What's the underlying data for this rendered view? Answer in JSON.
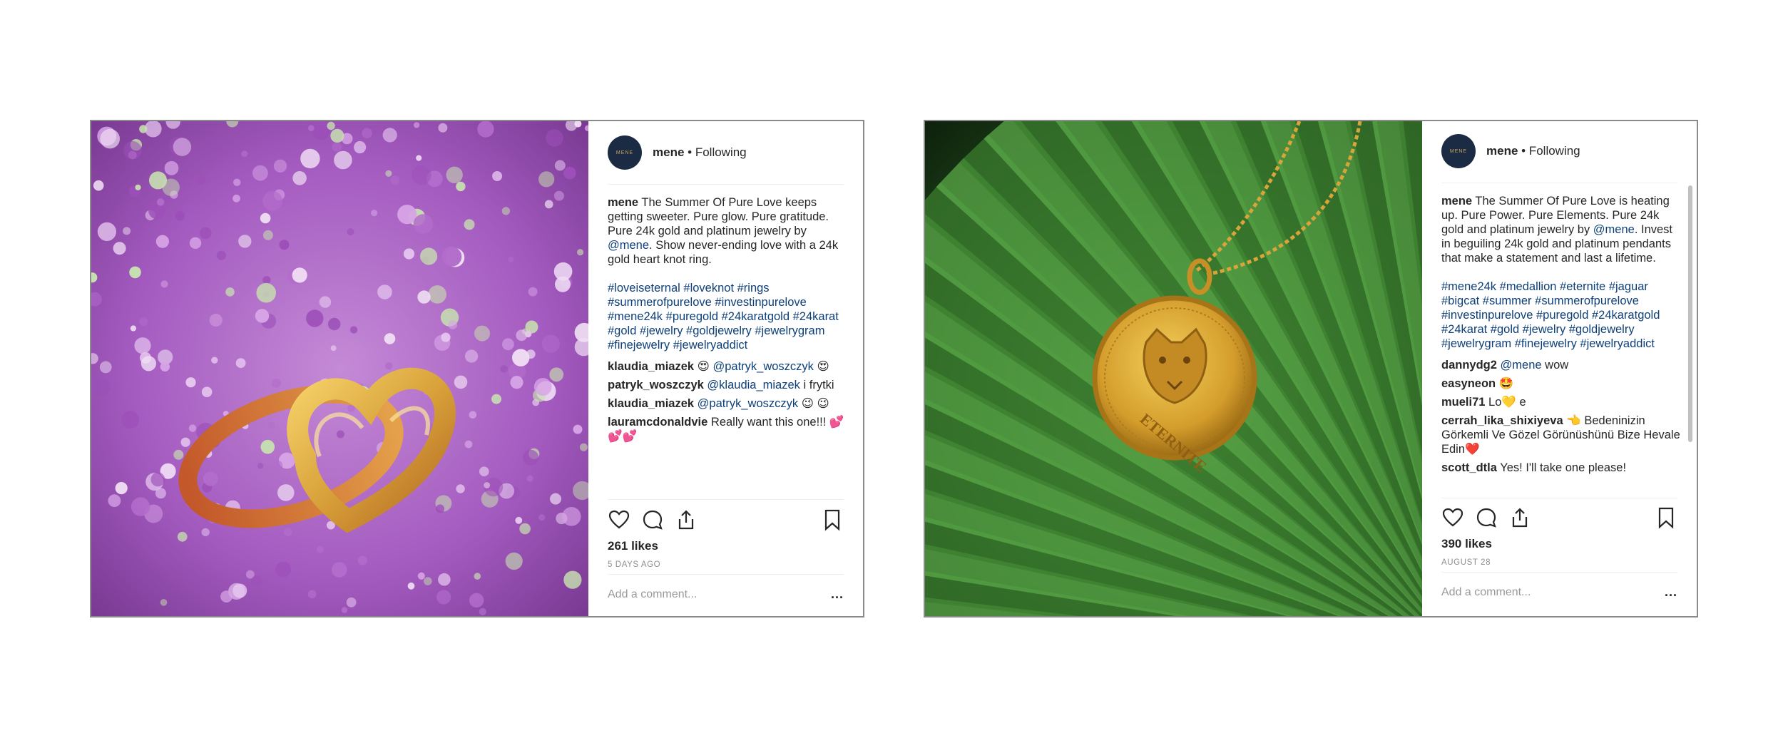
{
  "posts": [
    {
      "avatar_text": "MENE",
      "username": "mene",
      "follow_status": "• Following",
      "caption_user": "mene",
      "caption_text_1": "The Summer Of Pure Love keeps getting sweeter. Pure glow. Pure gratitude. Pure 24k gold and platinum jewelry by ",
      "caption_mention": "@mene",
      "caption_text_2": ". Show never-ending love with a 24k gold heart knot ring.",
      "hashtags": "#loveiseternal #loveknot #rings #summerofpurelove #investinpurelove #mene24k #puregold #24karatgold #24karat #gold #jewelry #goldjewelry #jewelrygram #finejewelry #jewelryaddict",
      "comments": [
        {
          "user": "klaudia_miazek",
          "pre": "😍 ",
          "mention": "@patryk_woszczyk",
          "post": " 😍"
        },
        {
          "user": "patryk_woszczyk",
          "pre": "",
          "mention": "@klaudia_miazek",
          "post": " i frytki"
        },
        {
          "user": "klaudia_miazek",
          "pre": "",
          "mention": "@patryk_woszczyk",
          "post": " 😉 😉"
        },
        {
          "user": "lauramcdonaldvie",
          "pre": "Really want this one!!! 💕💕💕",
          "mention": "",
          "post": ""
        }
      ],
      "likes": "261 likes",
      "date": "5 DAYS AGO",
      "add_comment_placeholder": "Add a comment...",
      "more": "..."
    },
    {
      "avatar_text": "MENE",
      "username": "mene",
      "follow_status": "• Following",
      "caption_user": "mene",
      "caption_text_1": "The Summer Of Pure Love is heating up. Pure Power. Pure Elements. Pure 24k gold and platinum jewelry by ",
      "caption_mention": "@mene",
      "caption_text_2": ". Invest in beguiling 24k gold and platinum pendants that make a statement and last a lifetime.",
      "hashtags": "#mene24k #medallion #eternite #jaguar #bigcat #summer #summerofpurelove #investinpurelove #puregold #24karatgold #24karat #gold #jewelry #goldjewelry #jewelrygram #finejewelry #jewelryaddict",
      "comments": [
        {
          "user": "dannydg2",
          "pre": "",
          "mention": "@mene",
          "post": " wow"
        },
        {
          "user": "easyneon",
          "pre": "🤩",
          "mention": "",
          "post": ""
        },
        {
          "user": "mueli71",
          "pre": "Lo💛 e",
          "mention": "",
          "post": ""
        },
        {
          "user": "cerrah_lika_shixiyeva",
          "pre": "👈 Bedeninizin Görkemli Ve Gözel Görünüshünü Bize Hevale Edin❤️",
          "mention": "",
          "post": ""
        },
        {
          "user": "scott_dtla",
          "pre": "Yes! I'll take one please!",
          "mention": "",
          "post": ""
        }
      ],
      "likes": "390 likes",
      "date": "AUGUST 28",
      "add_comment_placeholder": "Add a comment...",
      "more": "...",
      "medallion_text": "ETERNITE"
    }
  ],
  "colors": {
    "mention": "#0d3f78",
    "avatar_bg": "#1c2b44",
    "muted": "#8e8e8e"
  }
}
